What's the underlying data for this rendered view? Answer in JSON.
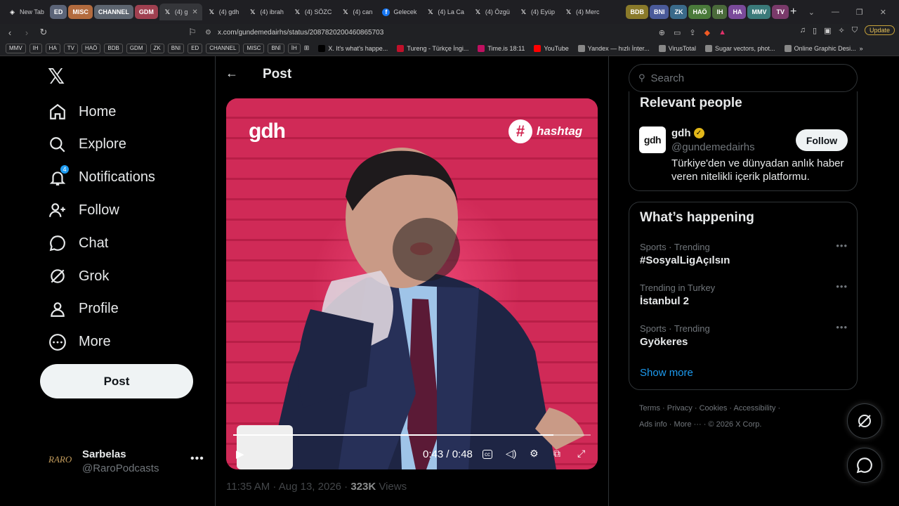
{
  "browser": {
    "tabs": [
      {
        "label": "New Tab",
        "icon": "shield-icon",
        "color": ""
      },
      {
        "label": "ED",
        "group": true,
        "color": "#5b6478"
      },
      {
        "label": "MISC",
        "group": true,
        "color": "#b36b3e"
      },
      {
        "label": "CHANNEL",
        "group": true,
        "color": "#5d6570"
      },
      {
        "label": "GDM",
        "group": true,
        "color": "#a04050"
      },
      {
        "label": "(4) g",
        "icon": "x-icon",
        "active": true
      },
      {
        "label": "(4) gdh",
        "icon": "x-icon"
      },
      {
        "label": "(4) ibrah",
        "icon": "x-icon"
      },
      {
        "label": "(4) SÖZC",
        "icon": "x-icon"
      },
      {
        "label": "(4) can",
        "icon": "x-icon"
      },
      {
        "label": "Gelecek",
        "icon": "facebook-icon"
      },
      {
        "label": "(4) La Ca",
        "icon": "x-icon"
      },
      {
        "label": "(4) Özgü",
        "icon": "x-icon"
      },
      {
        "label": "(4) Eyüp",
        "icon": "x-icon"
      },
      {
        "label": "(4) Merc",
        "icon": "x-icon"
      }
    ],
    "group_tabs_right": [
      {
        "label": "BDB",
        "color": "#8a7a2a"
      },
      {
        "label": "BNI",
        "color": "#4a5a9a"
      },
      {
        "label": "ZK",
        "color": "#3a6a8a"
      },
      {
        "label": "HAÖ",
        "color": "#4a7a3a"
      },
      {
        "label": "IH",
        "color": "#4a6a3a"
      },
      {
        "label": "HA",
        "color": "#7a4a9a"
      },
      {
        "label": "MMV",
        "color": "#3a7a7a"
      },
      {
        "label": "TV",
        "color": "#7a3a6a"
      }
    ],
    "url": "x.com/gundemedairhs/status/2087820200460865703",
    "update_label": "Update",
    "bookmark_tags": [
      "MMV",
      "IH",
      "HA",
      "TV",
      "HAÖ",
      "BDB",
      "GDM",
      "ZK",
      "BNI",
      "ED",
      "CHANNEL",
      "MISC",
      "BNİ",
      "İH"
    ],
    "bookmarks": [
      {
        "label": "X. It's what's happe...",
        "color": "#000000"
      },
      {
        "label": "Tureng - Türkçe İngi...",
        "color": "#c0102a"
      },
      {
        "label": "Time.is 18:11",
        "color": "#c01060"
      },
      {
        "label": "YouTube",
        "color": "#ff0000"
      },
      {
        "label": "Yandex — hızlı İnter...",
        "color": "#888888"
      },
      {
        "label": "VirusTotal",
        "color": "#888888"
      },
      {
        "label": "Sugar vectors, phot...",
        "color": "#888888"
      },
      {
        "label": "Online Graphic Desi...",
        "color": "#888888"
      }
    ]
  },
  "sidebar": {
    "nav": [
      {
        "label": "Home",
        "icon": "home-icon"
      },
      {
        "label": "Explore",
        "icon": "search-icon"
      },
      {
        "label": "Notifications",
        "icon": "bell-icon",
        "badge": "4"
      },
      {
        "label": "Follow",
        "icon": "follow-icon"
      },
      {
        "label": "Chat",
        "icon": "chat-icon"
      },
      {
        "label": "Grok",
        "icon": "grok-icon"
      },
      {
        "label": "Profile",
        "icon": "profile-icon"
      },
      {
        "label": "More",
        "icon": "more-icon"
      }
    ],
    "post_label": "Post",
    "account": {
      "name": "Sarbelas",
      "handle": "@RaroPodcasts",
      "avatar_text": "RARO"
    }
  },
  "main": {
    "title": "Post",
    "video": {
      "brand": "gdh",
      "hashtag": "hashtag",
      "time": "0:43 / 0:48",
      "progress": 0.895
    },
    "meta": {
      "time": "11:35 AM · Aug 13, 2026 · ",
      "views_count": "323K",
      "views_label": " Views"
    }
  },
  "right": {
    "search_placeholder": "Search",
    "relevant": {
      "title": "Relevant people",
      "name": "gdh",
      "handle": "@gundemedairhs",
      "bio": "Türkiye'den ve dünyadan anlık haber veren nitelikli içerik platformu.",
      "follow_label": "Follow",
      "avatar_text": "gdh"
    },
    "happening": {
      "title": "What’s happening",
      "trends": [
        {
          "context": "Sports · Trending",
          "topic": "#SosyalLigAçılsın"
        },
        {
          "context": "Trending in Turkey",
          "topic": "İstanbul 2"
        },
        {
          "context": "Sports · Trending",
          "topic": "Gyökeres"
        }
      ],
      "show_more": "Show more"
    },
    "footer": {
      "line1": [
        "Terms",
        "Privacy",
        "Cookies",
        "Accessibility"
      ],
      "line2": [
        "Ads info",
        "More ···",
        "© 2026 X Corp."
      ]
    }
  },
  "colors": {
    "accent": "#1d9bf0",
    "video_bg": "#d1254f"
  }
}
